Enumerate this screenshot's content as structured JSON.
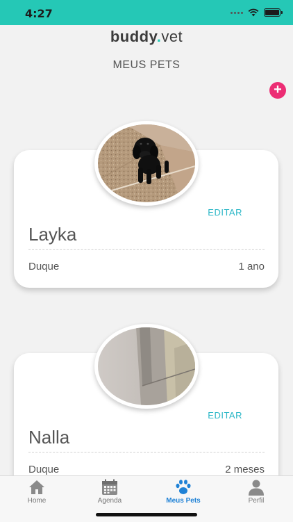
{
  "status_bar": {
    "time": "4:27",
    "color": "#25c8b6"
  },
  "brand": {
    "bold": "buddy",
    "dot": ".",
    "light": "vet",
    "accent": "#25c8b6"
  },
  "page": {
    "title": "MEUS PETS"
  },
  "actions": {
    "add_symbol": "+",
    "add_color": "#ec2d74"
  },
  "pets": [
    {
      "name": "Layka",
      "breed": "Duque",
      "age": "1 ano",
      "edit_label": "EDITAR",
      "photo": "black-puppy-photo"
    },
    {
      "name": "Nalla",
      "breed": "Duque",
      "age": "2 meses",
      "edit_label": "EDITAR",
      "photo": "room-corner-photo"
    }
  ],
  "tabbar": {
    "items": [
      {
        "label": "Home",
        "icon": "home-icon",
        "active": false
      },
      {
        "label": "Agenda",
        "icon": "calendar-icon",
        "active": false
      },
      {
        "label": "Meus Pets",
        "icon": "paw-icon",
        "active": true
      },
      {
        "label": "Perfil",
        "icon": "person-icon",
        "active": false
      }
    ],
    "active_color": "#1f82d6"
  }
}
